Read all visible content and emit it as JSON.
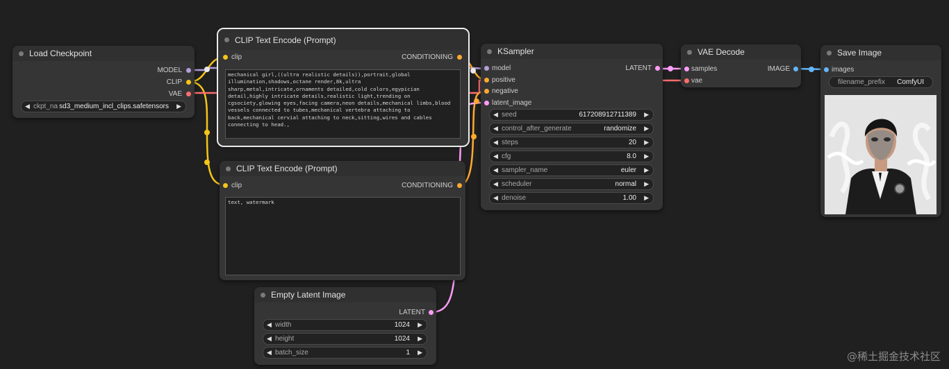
{
  "colors": {
    "model": "#b39ddb",
    "clip": "#f5c518",
    "vae": "#ff6e6e",
    "conditioning": "#ffa931",
    "latent": "#ff9cf9",
    "image": "#64b5f6"
  },
  "load_checkpoint": {
    "title": "Load Checkpoint",
    "outputs": [
      "MODEL",
      "CLIP",
      "VAE"
    ],
    "ckpt_name": "sd3_medium_incl_clips.safetensors",
    "ckpt_label": "ckpt_na"
  },
  "clip_pos": {
    "title": "CLIP Text Encode (Prompt)",
    "input": "clip",
    "output": "CONDITIONING",
    "text": "mechanical girl,((ultra realistic details)),portrait,global illumination,shadows,octane render,8k,ultra sharp,metal,intricate,ornaments detailed,cold colors,egypician detail,highly intricate details,realistic light,trending on cgsociety,glowing eyes,facing camera,neon details,mechanical limbs,blood vessels connected to tubes,mechanical vertebra attaching to back,mechanical cervial attaching to neck,sitting,wires and cables connecting to head.,"
  },
  "clip_neg": {
    "title": "CLIP Text Encode (Prompt)",
    "input": "clip",
    "output": "CONDITIONING",
    "text": "text, watermark"
  },
  "empty_latent": {
    "title": "Empty Latent Image",
    "output": "LATENT",
    "widgets": [
      {
        "name": "width",
        "value": "1024"
      },
      {
        "name": "height",
        "value": "1024"
      },
      {
        "name": "batch_size",
        "value": "1"
      }
    ]
  },
  "ksampler": {
    "title": "KSampler",
    "inputs": [
      "model",
      "positive",
      "negative",
      "latent_image"
    ],
    "output": "LATENT",
    "widgets": [
      {
        "name": "seed",
        "value": "617208912711389"
      },
      {
        "name": "control_after_generate",
        "value": "randomize"
      },
      {
        "name": "steps",
        "value": "20"
      },
      {
        "name": "cfg",
        "value": "8.0"
      },
      {
        "name": "sampler_name",
        "value": "euler"
      },
      {
        "name": "scheduler",
        "value": "normal"
      },
      {
        "name": "denoise",
        "value": "1.00"
      }
    ]
  },
  "vae_decode": {
    "title": "VAE Decode",
    "inputs": [
      "samples",
      "vae"
    ],
    "output": "IMAGE"
  },
  "save_image": {
    "title": "Save Image",
    "input": "images",
    "filename_prefix_label": "filename_prefix",
    "filename_prefix": "ComfyUI"
  },
  "watermark": "@稀土掘金技术社区",
  "icons": {
    "left_arrow": "◀",
    "right_arrow": "▶"
  }
}
